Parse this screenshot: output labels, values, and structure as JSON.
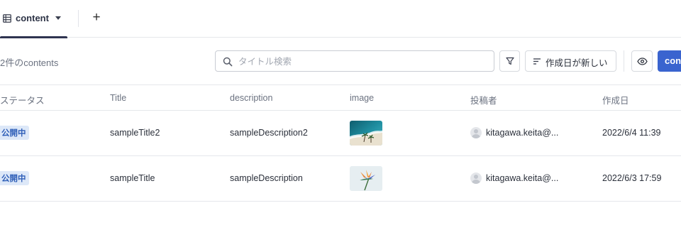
{
  "tabs": {
    "active_label": "content",
    "add_label": "+"
  },
  "toolbar": {
    "count_text": "2件のcontents",
    "search_placeholder": "タイトル検索",
    "sort_label": "作成日が新しい",
    "primary_label": "con"
  },
  "table": {
    "headers": {
      "status": "ステータス",
      "title": "Title",
      "description": "description",
      "image": "image",
      "author": "投稿者",
      "created": "作成日"
    },
    "rows": [
      {
        "status": "公開中",
        "title": "sampleTitle2",
        "description": "sampleDescription2",
        "image": "beach-photo",
        "author": "kitagawa.keita@...",
        "created": "2022/6/4 11:39"
      },
      {
        "status": "公開中",
        "title": "sampleTitle",
        "description": "sampleDescription",
        "image": "flower-photo",
        "author": "kitagawa.keita@...",
        "created": "2022/6/3 17:59"
      }
    ]
  },
  "colors": {
    "accent": "#3a64cf",
    "badge_bg": "#dde8f8",
    "badge_text": "#2f5fb8",
    "tab_underline": "#2f3450"
  },
  "icons": [
    "grid-list-icon",
    "caret-down-icon",
    "plus-icon",
    "search-icon",
    "filter-icon",
    "sort-icon",
    "eye-icon",
    "avatar-icon"
  ]
}
